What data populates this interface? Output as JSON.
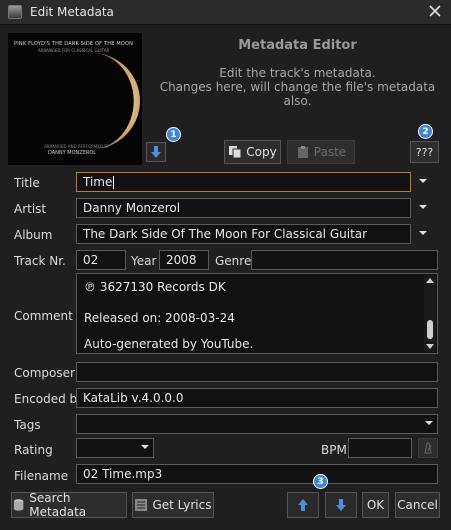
{
  "window": {
    "title": "Edit Metadata",
    "accent": "#c77b1f",
    "badge_color": "#3b86e0"
  },
  "cover": {
    "art_title": "PINK FLOYD'S THE DARK SIDE OF THE MOON",
    "art_subtitle": "ARRANGED FOR CLASSICAL GUITAR",
    "art_footer1": "ARRANGED AND PERFORMED BY",
    "art_footer2": "DANNY MONZEROL"
  },
  "editor": {
    "title": "Metadata Editor",
    "desc_line1": "Edit the track's metadata.",
    "desc_line2": "Changes here, will change the file's metadata also."
  },
  "toolbar": {
    "copy_label": "Copy",
    "paste_label": "Paste",
    "help_label": "???"
  },
  "badges": {
    "b1": "1",
    "b2": "2",
    "b3": "3"
  },
  "labels": {
    "title": "Title",
    "artist": "Artist",
    "album": "Album",
    "track": "Track Nr.",
    "year": "Year",
    "genre": "Genre",
    "comment": "Comment",
    "composer": "Composer",
    "encoded": "Encoded by",
    "tags": "Tags",
    "rating": "Rating",
    "bpm": "BPM",
    "filename": "Filename"
  },
  "values": {
    "title": "Time",
    "artist": "Danny Monzerol",
    "album": "The Dark Side Of The Moon For Classical Guitar",
    "track": "02",
    "year": "2008",
    "genre": "",
    "comment_lines": [
      "℗ 3627130 Records DK",
      "Released on: 2008-03-24",
      "Auto-generated by YouTube."
    ],
    "composer": "",
    "encoded": "KataLib v.4.0.0.0",
    "tags": "",
    "rating": "",
    "bpm": "",
    "filename": "02 Time.mp3"
  },
  "footer": {
    "search_label": "Search Metadata",
    "lyrics_label": "Get Lyrics",
    "ok_label": "OK",
    "cancel_label": "Cancel"
  }
}
